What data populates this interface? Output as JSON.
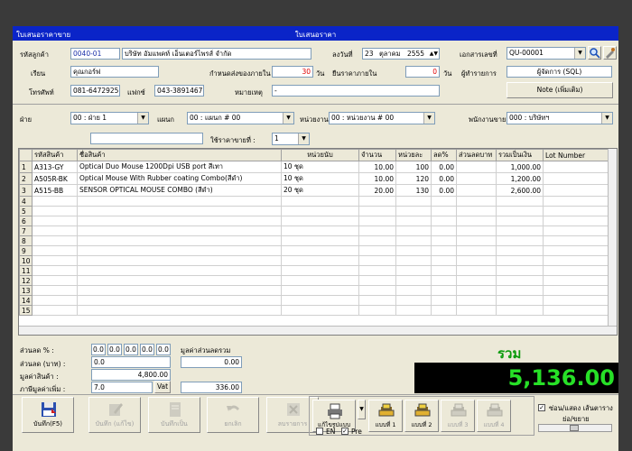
{
  "window": {
    "title_left": "ใบเสนอราคาขาย",
    "title_center": "ใบเสนอราคา"
  },
  "header": {
    "customer_code_label": "รหัสลูกค้า",
    "customer_code": "0040-01",
    "customer_name": "บริษัท อัมแพคท์ เอ็นเตอร์ไพรส์ จำกัด",
    "date_label": "ลงวันที่",
    "date_day": "23",
    "date_month": "ตุลาคม",
    "date_year": "2555",
    "doc_no_label": "เอกสารเลขที่",
    "doc_no": "QU-00001",
    "attn_label": "เรียน",
    "attn": "คุณกอร์ฟ",
    "delivery_label": "กำหนดส่งของภายใน",
    "delivery_days": "30",
    "days_unit": "วัน",
    "valid_label": "ยืนราคาภายใน",
    "valid_days": "0",
    "valid_unit": "วัน",
    "maker_label": "ผู้ทำรายการ",
    "maker": "ผู้จัดการ (SQL)",
    "phone_label": "โทรศัพท์",
    "phone": "081-6472925",
    "fax_label": "แฟกซ์",
    "fax": "043-3891467",
    "remark_label": "หมายเหตุ",
    "remark": "-",
    "note_button": "Note (เพิ่มเติม)"
  },
  "filters": {
    "dept_label": "ฝ่าย",
    "dept": "00 : ฝ่าย 1",
    "section_label": "แผนก",
    "section": "00 : แผนก # 00",
    "unit_label": "หน่วยงาน",
    "unit": "00 : หน่วยงาน # 00",
    "sales_label": "พนักงานขาย",
    "sales": "000 : บริษัทฯ",
    "price_level_label": "ใช้ราคาขายที่ :",
    "price_level": "1"
  },
  "table": {
    "columns": [
      "รหัสสินค้า",
      "ชื่อสินค้า",
      "หน่วยนับ",
      "จำนวน",
      "หน่วยละ",
      "ลด%",
      "ส่วนลดบาท",
      "รวมเป็นเงิน",
      "Lot Number"
    ],
    "rows": [
      {
        "no": "1",
        "code": "A313-GY",
        "name": "Optical Duo Mouse 1200Dpi USB port สีเทา",
        "unit": "10 ชุด",
        "qty": "10.00",
        "price": "100",
        "disc_pct": "0.00",
        "disc_baht": "",
        "amount": "1,000.00",
        "lot": ""
      },
      {
        "no": "2",
        "code": "A505R-BK",
        "name": "Optical Mouse With Rubber coating Combo(สีดำ)",
        "unit": "10 ชุด",
        "qty": "10.00",
        "price": "120",
        "disc_pct": "0.00",
        "disc_baht": "",
        "amount": "1,200.00",
        "lot": ""
      },
      {
        "no": "3",
        "code": "A515-BB",
        "name": "SENSOR OPTICAL MOUSE COMBO (สีดำ)",
        "unit": "20 ชุด",
        "qty": "20.00",
        "price": "130",
        "disc_pct": "0.00",
        "disc_baht": "",
        "amount": "2,600.00",
        "lot": ""
      }
    ],
    "empty_rows": [
      "4",
      "5",
      "6",
      "7",
      "8",
      "9",
      "10",
      "11",
      "12",
      "13",
      "14",
      "15"
    ]
  },
  "summary": {
    "disc_pct_label": "ส่วนลด % :",
    "disc_pct_values": [
      "0.0",
      "0.0",
      "0.0",
      "0.0",
      "0.0"
    ],
    "total_disc_label": "มูลค่าส่วนลดรวม",
    "total_disc": "0.00",
    "disc_baht_label": "ส่วนลด (บาท) :",
    "disc_baht": "0.0",
    "goods_value_label": "มูลค่าสินค้า :",
    "goods_value": "4,800.00",
    "vat_label": "ภาษีมูลค่าเพิ่ม :",
    "vat_rate": "7.0",
    "vat_button": "Vat",
    "vat_amount": "336.00",
    "grand_total_label": "รวม",
    "grand_total": "5,136.00"
  },
  "actions": {
    "save": "บันทึก(F5)",
    "save_edit": "บันทึก (แก้ไข)",
    "save_as": "บันทึกเป็น",
    "cancel": "ยกเลิก",
    "delete_item": "ลบรายการ",
    "printer": "แก้ไขรูปแบบ",
    "form1": "แบบที่ 1",
    "form2": "แบบที่ 2",
    "form3": "แบบที่ 3",
    "form4": "แบบที่ 4",
    "en_label": "EN",
    "pre_label": "Pre",
    "show_lines_label": "ซ่อน/แสดง เส้นตาราง",
    "expand_label": "ย่อ/ขยาย"
  }
}
